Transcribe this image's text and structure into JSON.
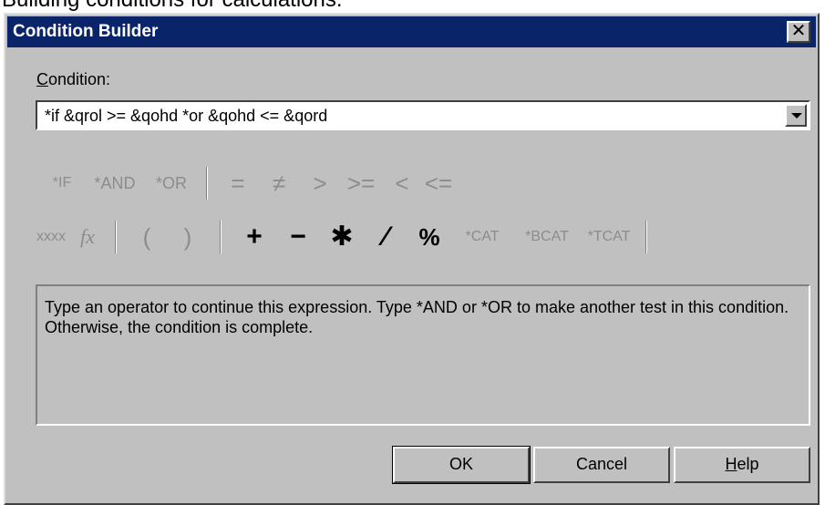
{
  "caption": "Building conditions for calculations.",
  "window": {
    "title": "Condition Builder",
    "close_glyph": "✕"
  },
  "condition": {
    "label_mnemonic": "C",
    "label_rest": "ondition:",
    "value": "*if &qrol >= &qohd *or &qohd <=  &qord"
  },
  "toolbar": {
    "row1": [
      "*IF",
      "*AND",
      "*OR",
      "=",
      "≠",
      ">",
      ">=",
      "<",
      "<="
    ],
    "row2": [
      "xxxx",
      "fx",
      "(",
      ")",
      "+",
      "−",
      "✱",
      "⁄",
      "%",
      "*CAT",
      "*BCAT",
      "*TCAT"
    ]
  },
  "message": "Type an operator to continue this expression.  Type *AND or *OR to make another test in this condition.  Otherwise, the condition is complete.",
  "buttons": {
    "ok": "OK",
    "cancel": "Cancel",
    "help_mnemonic": "H",
    "help_rest": "elp"
  },
  "colors": {
    "titlebar": "#0a246a",
    "face": "#c0c0c0",
    "disabled_text": "#8c8c8c"
  }
}
